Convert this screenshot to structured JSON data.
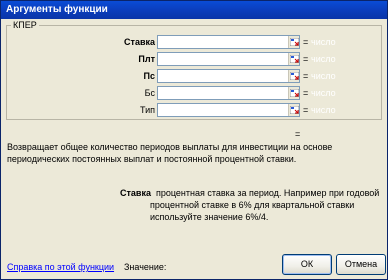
{
  "window": {
    "title": "Аргументы функции"
  },
  "function_group": {
    "name": "КПЕР",
    "arguments": [
      {
        "label": "Ставка",
        "value": "",
        "result_prefix": "=",
        "result": "число"
      },
      {
        "label": "Плт",
        "value": "",
        "result_prefix": "=",
        "result": "число"
      },
      {
        "label": "Пс",
        "value": "",
        "result_prefix": "=",
        "result": "число"
      },
      {
        "label": "Бс",
        "value": "",
        "result_prefix": "=",
        "result": "число"
      },
      {
        "label": "Тип",
        "value": "",
        "result_prefix": "=",
        "result": "число"
      }
    ],
    "result_eq": "="
  },
  "description": {
    "function_desc": "Возвращает общее количество периодов выплаты для инвестиции на основе периодических постоянных выплат и постоянной процентной ставки.",
    "argument_name": "Ставка",
    "argument_desc": "процентная ставка за период. Например при годовой процентной ставке в 6% для квартальной ставки используйте значение 6%/4."
  },
  "footer": {
    "help_link": "Справка по этой функции",
    "value_label": "Значение:",
    "ok_label": "ОК",
    "cancel_label": "Отмена"
  },
  "colors": {
    "titlebar": "#0a4cd6",
    "dialog_bg": "#ece9d8",
    "link": "#0000ff"
  }
}
